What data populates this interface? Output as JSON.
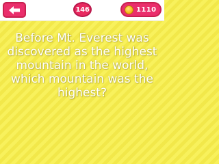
{
  "header": {
    "level": "146",
    "coins": "1110"
  },
  "icons": {
    "back": "back-arrow-icon",
    "coin": "coin-icon"
  },
  "question": {
    "text": "Before Mt. Everest was discovered as the highest mountain in the world, which mountain was the highest?"
  },
  "colors": {
    "background": "#f8f15c",
    "accent": "#ea2e6c",
    "question_text": "#ffffff"
  }
}
